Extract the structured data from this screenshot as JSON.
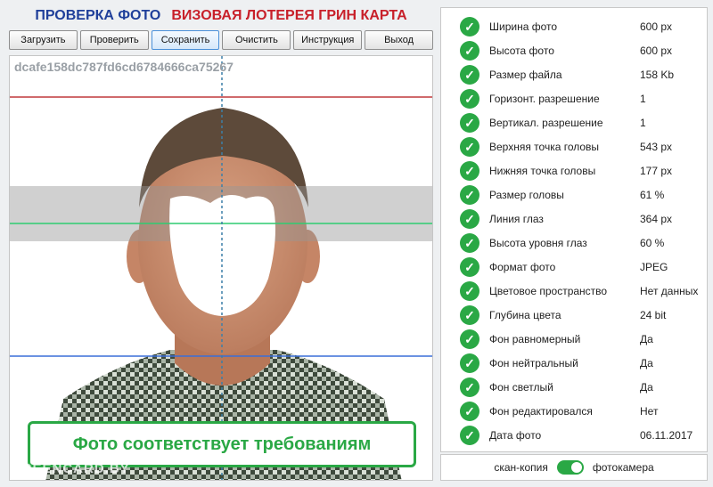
{
  "header": {
    "title_left": "ПРОВЕРКА ФОТО",
    "title_right": "ВИЗОВАЯ ЛОТЕРЕЯ ГРИН КАРТА"
  },
  "toolbar": {
    "buttons": [
      "Загрузить",
      "Проверить",
      "Сохранить",
      "Очистить",
      "Инструкция",
      "Выход"
    ],
    "active_index": 2
  },
  "photo": {
    "filename": "dcafe158dc787fd6cd6784666ca75267",
    "status": "Фото соответствует требованиям",
    "watermark": "GREENCARD.BY"
  },
  "colors": {
    "accent_green": "#2aa845",
    "title_blue": "#1f3f9a",
    "title_red": "#c8202a",
    "guide_red": "#c0393b",
    "guide_green": "#2ecc71",
    "guide_blue": "#3a6fd8"
  },
  "checks": [
    {
      "label": "Ширина фото",
      "value": "600 px",
      "icon": "check-icon"
    },
    {
      "label": "Высота фото",
      "value": "600 px",
      "icon": "check-icon"
    },
    {
      "label": "Размер файла",
      "value": "158 Kb",
      "icon": "check-icon"
    },
    {
      "label": "Горизонт. разрешение",
      "value": "1",
      "icon": "check-icon"
    },
    {
      "label": "Вертикал. разрешение",
      "value": "1",
      "icon": "check-icon"
    },
    {
      "label": "Верхняя точка головы",
      "value": "543 px",
      "icon": "check-icon"
    },
    {
      "label": "Нижняя точка головы",
      "value": "177 px",
      "icon": "check-icon"
    },
    {
      "label": "Размер головы",
      "value": "61 %",
      "icon": "check-icon"
    },
    {
      "label": "Линия глаз",
      "value": "364 px",
      "icon": "check-icon"
    },
    {
      "label": "Высота уровня глаз",
      "value": "60 %",
      "icon": "check-icon"
    },
    {
      "label": "Формат фото",
      "value": "JPEG",
      "icon": "check-icon"
    },
    {
      "label": "Цветовое пространство",
      "value": "Нет данных",
      "icon": "check-icon"
    },
    {
      "label": "Глубина цвета",
      "value": "24 bit",
      "icon": "check-icon"
    },
    {
      "label": "Фон равномерный",
      "value": "Да",
      "icon": "check-icon"
    },
    {
      "label": "Фон нейтральный",
      "value": "Да",
      "icon": "check-icon"
    },
    {
      "label": "Фон светлый",
      "value": "Да",
      "icon": "check-icon"
    },
    {
      "label": "Фон редактировался",
      "value": "Нет",
      "icon": "check-icon"
    },
    {
      "label": "Дата фото",
      "value": "06.11.2017",
      "icon": "check-icon"
    }
  ],
  "footer": {
    "left_label": "скан-копия",
    "right_label": "фотокамера",
    "toggle_on": true
  }
}
